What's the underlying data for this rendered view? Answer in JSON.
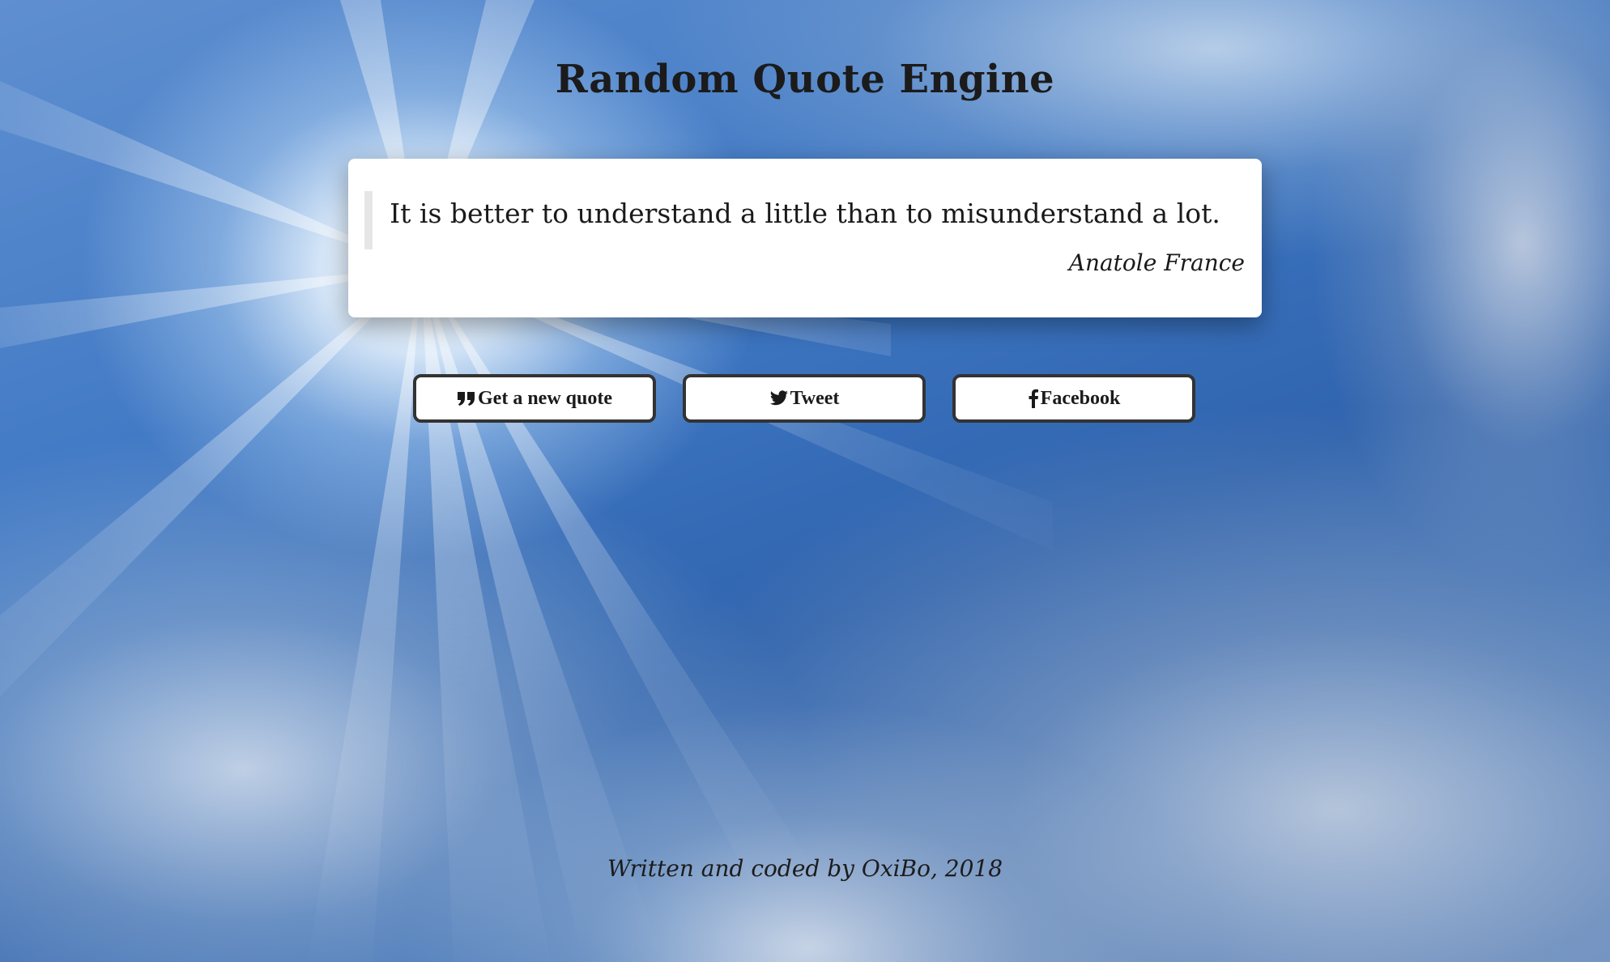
{
  "page": {
    "title": "Random Quote Engine"
  },
  "quote": {
    "text": "It is better to understand a little than to misunderstand a lot.",
    "author": "Anatole France"
  },
  "buttons": {
    "new_quote": {
      "label": "Get a new quote",
      "icon": "quote-left-icon"
    },
    "tweet": {
      "label": "Tweet",
      "icon": "twitter-icon"
    },
    "facebook": {
      "label": "Facebook",
      "icon": "facebook-icon"
    }
  },
  "footer": {
    "text": "Written and coded by OxiBo, 2018"
  },
  "colors": {
    "card_background": "#ffffff",
    "button_border": "#333333",
    "text": "#1a1a1a",
    "sky": "#3f78c4"
  }
}
